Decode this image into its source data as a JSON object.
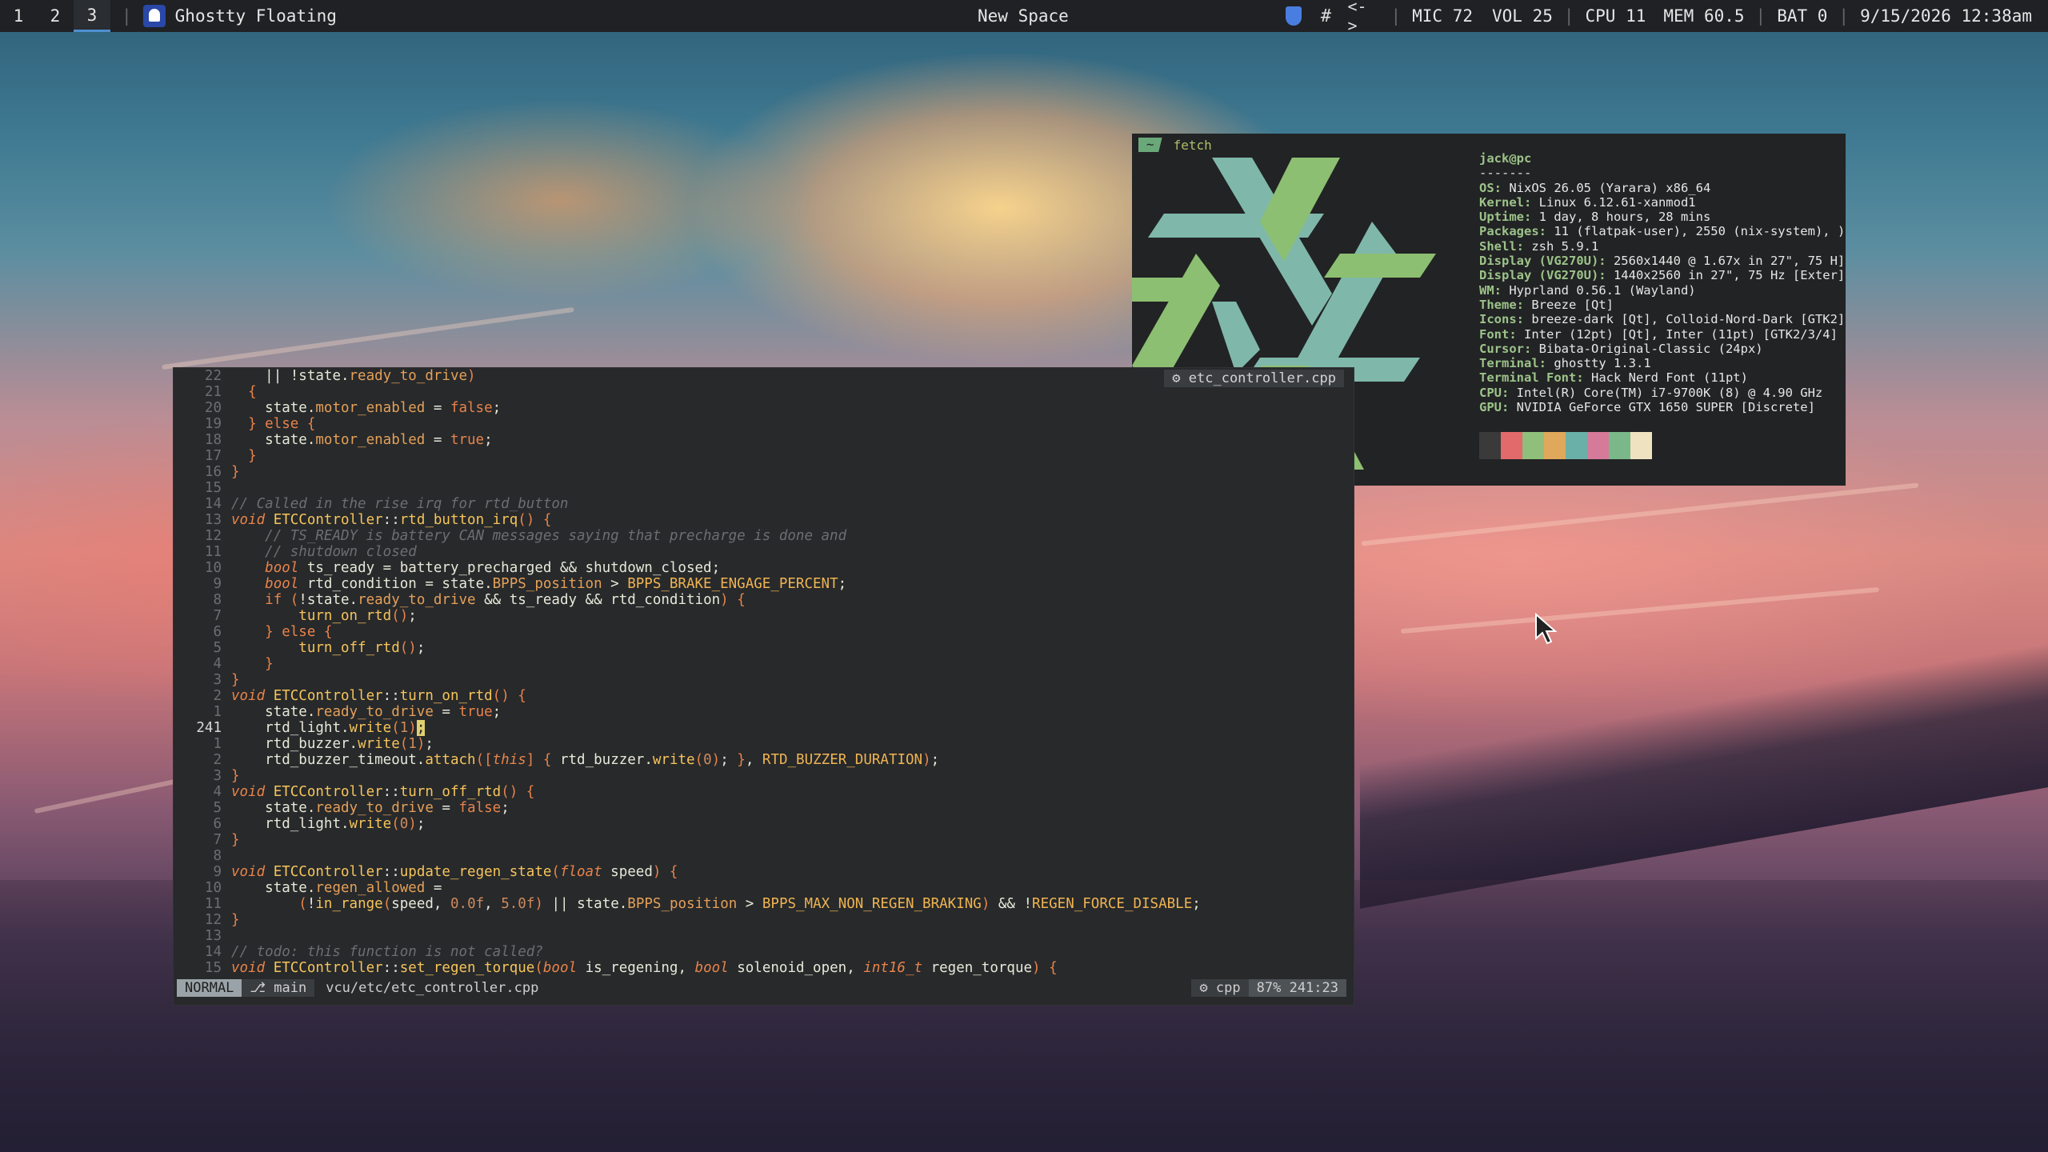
{
  "topbar": {
    "workspaces": [
      "1",
      "2",
      "3"
    ],
    "active_workspace": "3",
    "window_title": "Ghostty Floating",
    "center_title": "New Space",
    "mic": "MIC 72",
    "vol": "VOL 25",
    "cpu": "CPU 11",
    "mem": "MEM 60.5",
    "bat": "BAT 0",
    "datetime": "9/15/2026 12:38am",
    "tray_icons": [
      "bitwarden-icon",
      "slack-icon",
      "network-arrows-icon"
    ]
  },
  "editor": {
    "file_tab": "etc_controller.cpp",
    "lines": [
      {
        "n": "22",
        "html": "    <span class=\"code\">|| !state.</span><span class=\"m\">ready_to_drive</span><span class=\"k\">)</span>"
      },
      {
        "n": "21",
        "html": "  <span class=\"k\">{</span>"
      },
      {
        "n": "20",
        "html": "    <span class=\"code\">state.</span><span class=\"m\">motor_enabled</span><span class=\"code\"> = </span><span class=\"k\">false</span><span class=\"code\">;</span>"
      },
      {
        "n": "19",
        "html": "  <span class=\"k\">} else {</span>"
      },
      {
        "n": "18",
        "html": "    <span class=\"code\">state.</span><span class=\"m\">motor_enabled</span><span class=\"code\"> = </span><span class=\"k\">true</span><span class=\"code\">;</span>"
      },
      {
        "n": "17",
        "html": "  <span class=\"k\">}</span>"
      },
      {
        "n": "16",
        "html": "<span class=\"k\">}</span>"
      },
      {
        "n": "15",
        "html": ""
      },
      {
        "n": "14",
        "html": "<span class=\"c\">// Called in the rise irq for rtd_button</span>"
      },
      {
        "n": "13",
        "html": "<span class=\"ty\">void</span><span class=\"code\"> </span><span class=\"f\">ETCController</span><span class=\"code\">::</span><span class=\"f\">rtd_button_irq</span><span class=\"k\">() {</span>"
      },
      {
        "n": "12",
        "html": "    <span class=\"c\">// TS_READY is battery CAN messages saying that precharge is done and</span>"
      },
      {
        "n": "11",
        "html": "    <span class=\"c\">// shutdown closed</span>"
      },
      {
        "n": "10",
        "html": "    <span class=\"ty\">bool</span><span class=\"code\"> ts_ready = battery_precharged &amp;&amp; shutdown_closed;</span>"
      },
      {
        "n": "9",
        "html": "    <span class=\"ty\">bool</span><span class=\"code\"> rtd_condition = state.</span><span class=\"m\">BPPS_position</span><span class=\"code\"> &gt; </span><span class=\"ns\">BPPS_BRAKE_ENGAGE_PERCENT</span><span class=\"code\">;</span>"
      },
      {
        "n": "8",
        "html": "    <span class=\"k\">if (</span><span class=\"code\">!state.</span><span class=\"m\">ready_to_drive</span><span class=\"code\"> &amp;&amp; ts_ready &amp;&amp; rtd_condition</span><span class=\"k\">) {</span>"
      },
      {
        "n": "7",
        "html": "        <span class=\"f\">turn_on_rtd</span><span class=\"k\">()</span><span class=\"code\">;</span>"
      },
      {
        "n": "6",
        "html": "    <span class=\"k\">} else {</span>"
      },
      {
        "n": "5",
        "html": "        <span class=\"f\">turn_off_rtd</span><span class=\"k\">()</span><span class=\"code\">;</span>"
      },
      {
        "n": "4",
        "html": "    <span class=\"k\">}</span>"
      },
      {
        "n": "3",
        "html": "<span class=\"k\">}</span>"
      },
      {
        "n": "2",
        "html": "<span class=\"ty\">void</span><span class=\"code\"> </span><span class=\"f\">ETCController</span><span class=\"code\">::</span><span class=\"f\">turn_on_rtd</span><span class=\"k\">() {</span>"
      },
      {
        "n": "1",
        "html": "    <span class=\"code\">state.</span><span class=\"m\">ready_to_drive</span><span class=\"code\"> = </span><span class=\"k\">true</span><span class=\"code\">;</span>"
      },
      {
        "n": "241",
        "cur": true,
        "html": "    <span class=\"code\">rtd_light.</span><span class=\"f\">write</span><span class=\"k\">(</span><span class=\"n\">1</span><span class=\"k\">)</span><span class=\"cursor\">;</span>"
      },
      {
        "n": "1",
        "html": "    <span class=\"code\">rtd_buzzer.</span><span class=\"f\">write</span><span class=\"k\">(</span><span class=\"n\">1</span><span class=\"k\">)</span><span class=\"code\">;</span>"
      },
      {
        "n": "2",
        "html": "    <span class=\"code\">rtd_buzzer_timeout.</span><span class=\"f\">attach</span><span class=\"k\">([</span><span class=\"ty\">this</span><span class=\"k\">]</span><span class=\"code\"> </span><span class=\"k\">{</span><span class=\"code\"> rtd_buzzer.</span><span class=\"f\">write</span><span class=\"k\">(</span><span class=\"n\">0</span><span class=\"k\">)</span><span class=\"code\">; </span><span class=\"k\">}</span><span class=\"code\">, </span><span class=\"ns\">RTD_BUZZER_DURATION</span><span class=\"k\">)</span><span class=\"code\">;</span>"
      },
      {
        "n": "3",
        "html": "<span class=\"k\">}</span>"
      },
      {
        "n": "4",
        "html": "<span class=\"ty\">void</span><span class=\"code\"> </span><span class=\"f\">ETCController</span><span class=\"code\">::</span><span class=\"f\">turn_off_rtd</span><span class=\"k\">() {</span>"
      },
      {
        "n": "5",
        "html": "    <span class=\"code\">state.</span><span class=\"m\">ready_to_drive</span><span class=\"code\"> = </span><span class=\"k\">false</span><span class=\"code\">;</span>"
      },
      {
        "n": "6",
        "html": "    <span class=\"code\">rtd_light.</span><span class=\"f\">write</span><span class=\"k\">(</span><span class=\"n\">0</span><span class=\"k\">)</span><span class=\"code\">;</span>"
      },
      {
        "n": "7",
        "html": "<span class=\"k\">}</span>"
      },
      {
        "n": "8",
        "html": ""
      },
      {
        "n": "9",
        "html": "<span class=\"ty\">void</span><span class=\"code\"> </span><span class=\"f\">ETCController</span><span class=\"code\">::</span><span class=\"f\">update_regen_state</span><span class=\"k\">(</span><span class=\"ty\">float</span><span class=\"code\"> speed</span><span class=\"k\">) {</span>"
      },
      {
        "n": "10",
        "html": "    <span class=\"code\">state.</span><span class=\"m\">regen_allowed</span><span class=\"code\"> =</span>"
      },
      {
        "n": "11",
        "html": "        <span class=\"k\">(</span><span class=\"code\">!</span><span class=\"f\">in_range</span><span class=\"k\">(</span><span class=\"code\">speed, </span><span class=\"n\">0.0f</span><span class=\"code\">, </span><span class=\"n\">5.0f</span><span class=\"k\">)</span><span class=\"code\"> || state.</span><span class=\"m\">BPPS_position</span><span class=\"code\"> &gt; </span><span class=\"ns\">BPPS_MAX_NON_REGEN_BRAKING</span><span class=\"k\">)</span><span class=\"code\"> &amp;&amp; !</span><span class=\"ns\">REGEN_FORCE_DISABLE</span><span class=\"code\">;</span>"
      },
      {
        "n": "12",
        "html": "<span class=\"k\">}</span>"
      },
      {
        "n": "13",
        "html": ""
      },
      {
        "n": "14",
        "html": "<span class=\"c\">// todo: this function is not called?</span>"
      },
      {
        "n": "15",
        "html": "<span class=\"ty\">void</span><span class=\"code\"> </span><span class=\"f\">ETCController</span><span class=\"code\">::</span><span class=\"f\">set_regen_torque</span><span class=\"k\">(</span><span class=\"ty\">bool</span><span class=\"code\"> is_regening, </span><span class=\"ty\">bool</span><span class=\"code\"> solenoid_open, </span><span class=\"ty\">int16_t</span><span class=\"code\"> regen_torque</span><span class=\"k\">) {</span>"
      }
    ],
    "status": {
      "mode": "NORMAL",
      "branch": "main",
      "path": "vcu/etc/etc_controller.cpp",
      "filetype": "cpp",
      "position": "87% 241:23"
    }
  },
  "fetch": {
    "tab_tilde": "~",
    "tab_label": "fetch",
    "user": "jack@pc",
    "divider": "-------",
    "rows": [
      {
        "key": "OS",
        "val": "NixOS 26.05 (Yarara) x86_64"
      },
      {
        "key": "Kernel",
        "val": "Linux 6.12.61-xanmod1"
      },
      {
        "key": "Uptime",
        "val": "1 day, 8 hours, 28 mins"
      },
      {
        "key": "Packages",
        "val": "11 (flatpak-user), 2550 (nix-system), )"
      },
      {
        "key": "Shell",
        "val": "zsh 5.9.1"
      },
      {
        "key": "Display (VG270U)",
        "val": "2560x1440 @ 1.67x in 27\", 75 H]"
      },
      {
        "key": "Display (VG270U)",
        "val": "1440x2560 in 27\", 75 Hz [Exter]"
      },
      {
        "key": "WM",
        "val": "Hyprland 0.56.1 (Wayland)"
      },
      {
        "key": "Theme",
        "val": "Breeze [Qt]"
      },
      {
        "key": "Icons",
        "val": "breeze-dark [Qt], Colloid-Nord-Dark [GTK2]"
      },
      {
        "key": "Font",
        "val": "Inter (12pt) [Qt], Inter (11pt) [GTK2/3/4]"
      },
      {
        "key": "Cursor",
        "val": "Bibata-Original-Classic (24px)"
      },
      {
        "key": "Terminal",
        "val": "ghostty 1.3.1"
      },
      {
        "key": "Terminal Font",
        "val": "Hack Nerd Font (11pt)"
      },
      {
        "key": "CPU",
        "val": "Intel(R) Core(TM) i7-9700K (8) @ 4.90 GHz"
      },
      {
        "key": "GPU",
        "val": "NVIDIA GeForce GTX 1650 SUPER [Discrete]"
      }
    ],
    "swatch_colors": [
      "#3a3a3a",
      "#e26a6a",
      "#8fbf7a",
      "#e0a85a",
      "#6ab0a8",
      "#d67a9a",
      "#7ab88a",
      "#efe2c0"
    ],
    "logo_colors": {
      "teal": "#7fb8aa",
      "green": "#8cbf72"
    }
  }
}
